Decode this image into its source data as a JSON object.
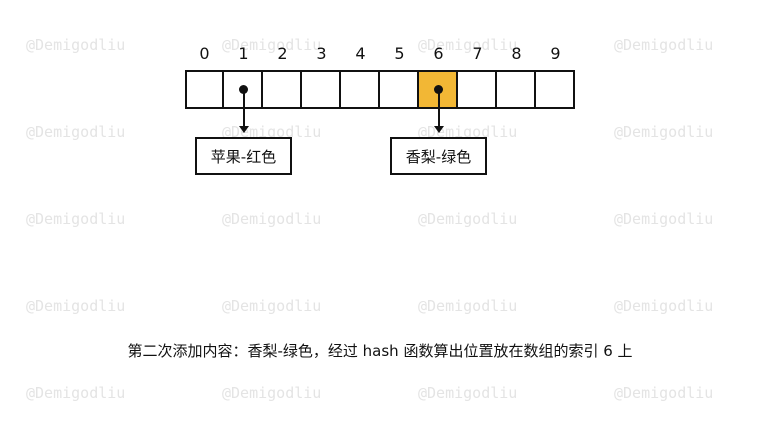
{
  "watermark": "@Demigodliu",
  "table": {
    "indices": [
      "0",
      "1",
      "2",
      "3",
      "4",
      "5",
      "6",
      "7",
      "8",
      "9"
    ],
    "highlighted_index": 6
  },
  "entries": [
    {
      "slot": 1,
      "text": "苹果-红色"
    },
    {
      "slot": 6,
      "text": "香梨-绿色"
    }
  ],
  "colors": {
    "highlight": "#f2b735",
    "outline": "#111111",
    "watermark": "#e4e4e4"
  },
  "caption": "第二次添加内容：香梨-绿色，经过 hash 函数算出位置放在数组的索引 6 上"
}
